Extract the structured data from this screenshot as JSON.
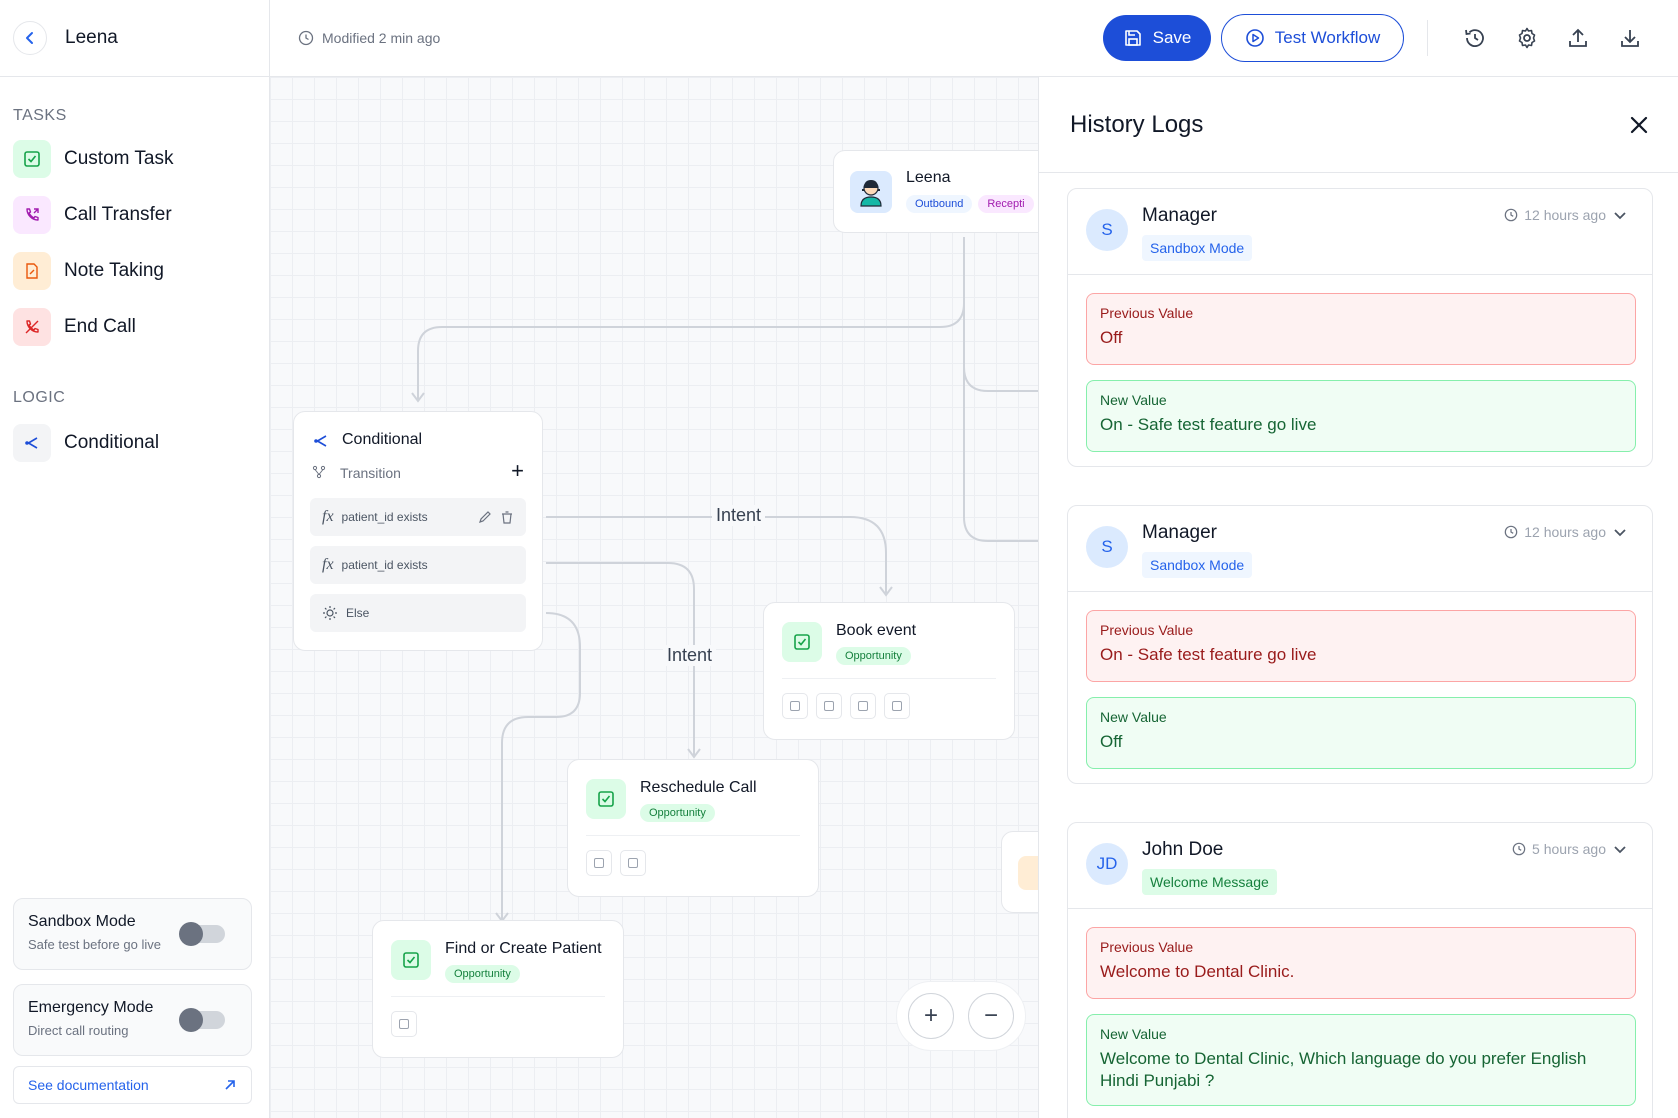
{
  "sidebar": {
    "title": "Leena",
    "tasks_label": "TASKS",
    "tasks": [
      {
        "label": "Custom Task",
        "icon": "check-square-icon"
      },
      {
        "label": "Call Transfer",
        "icon": "phone-forward-icon"
      },
      {
        "label": "Note Taking",
        "icon": "note-icon"
      },
      {
        "label": "End Call",
        "icon": "phone-off-icon"
      }
    ],
    "logic_label": "LOGIC",
    "logic": [
      {
        "label": "Conditional",
        "icon": "branch-icon"
      }
    ],
    "sandbox": {
      "title": "Sandbox Mode",
      "subtitle": "Safe test before go live"
    },
    "emergency": {
      "title": "Emergency Mode",
      "subtitle": "Direct call routing"
    },
    "doc_link": "See documentation"
  },
  "topbar": {
    "modified": "Modified 2 min ago",
    "save": "Save",
    "test": "Test Workflow"
  },
  "canvas": {
    "start_node": {
      "name": "Leena",
      "badges": [
        "Outbound",
        "Recepti"
      ]
    },
    "conditional": {
      "title": "Conditional",
      "transition": "Transition",
      "rows": [
        "patient_id exists",
        "patient_id exists",
        "Else"
      ]
    },
    "edge_labels": [
      "Intent",
      "Intent"
    ],
    "nodes": [
      {
        "title": "Book event",
        "badge": "Opportunity"
      },
      {
        "title": "Reschedule Call",
        "badge": "Opportunity"
      },
      {
        "title": "Find or Create Patient",
        "badge": "Opportunity"
      }
    ],
    "zoom": {
      "in": "+",
      "out": "−"
    }
  },
  "history": {
    "title": "History Logs",
    "prev_label": "Previous Value",
    "new_label": "New Value",
    "logs": [
      {
        "initials": "S",
        "name": "Manager",
        "tag": "Sandbox Mode",
        "time": "12 hours ago",
        "previous": "Off",
        "new": "On - Safe test feature go live"
      },
      {
        "initials": "S",
        "name": "Manager",
        "tag": "Sandbox Mode",
        "time": "12 hours ago",
        "previous": "On - Safe test feature go live",
        "new": "Off"
      },
      {
        "initials": "JD",
        "name": "John Doe",
        "tag": "Welcome Message",
        "time": "5 hours ago",
        "previous": "Welcome to Dental Clinic.",
        "new": "Welcome to Dental Clinic, Which language do you prefer English Hindi Punjabi ?"
      }
    ]
  },
  "colors": {
    "accent": "#1d4ed8",
    "success": "#15803d",
    "danger": "#991b1b"
  }
}
